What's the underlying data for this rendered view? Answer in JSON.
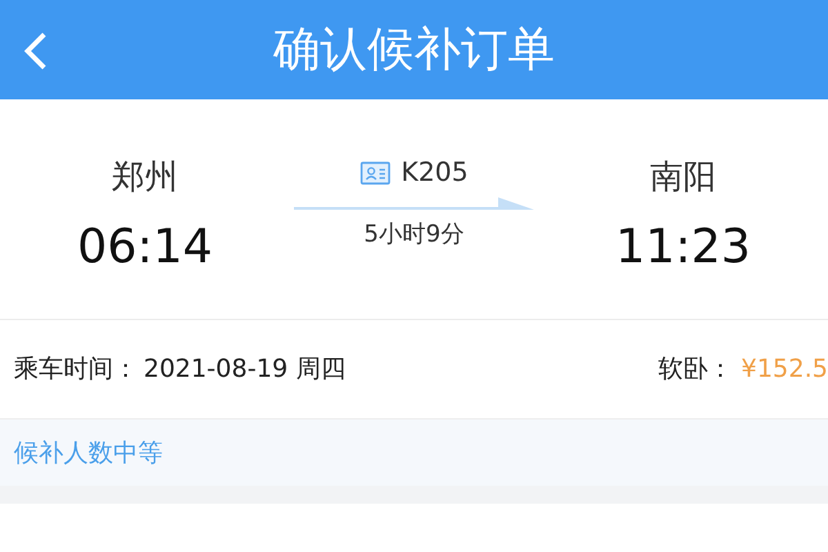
{
  "header": {
    "title": "确认候补订单"
  },
  "train": {
    "from_station": "郑州",
    "from_time": "06:14",
    "number": "K205",
    "duration": "5小时9分",
    "to_station": "南阳",
    "to_time": "11:23"
  },
  "ride": {
    "date_label": "乘车时间：",
    "date": "2021-08-19 周四",
    "seat_label": "软卧：",
    "price": "¥152.5"
  },
  "notice": "候补人数中等"
}
